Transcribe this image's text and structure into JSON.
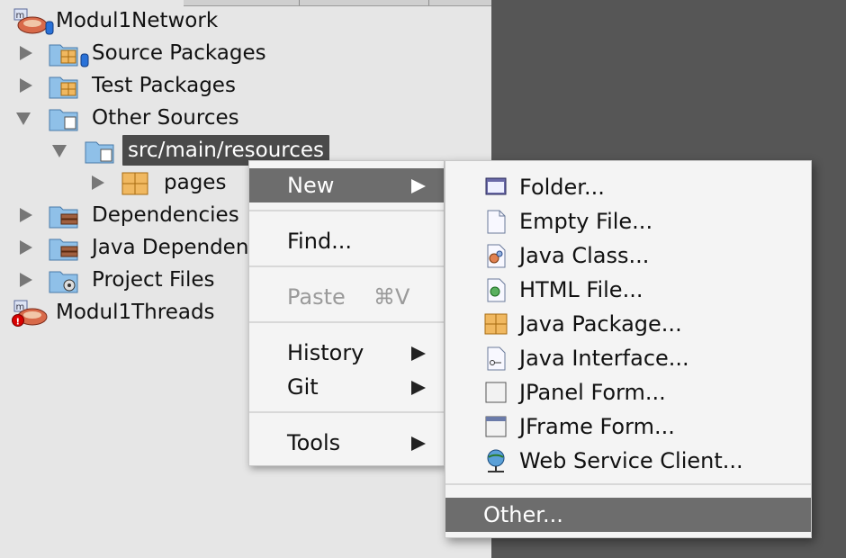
{
  "tree": {
    "nodes": [
      {
        "label": "Modul1Network"
      },
      {
        "label": "Source Packages"
      },
      {
        "label": "Test Packages"
      },
      {
        "label": "Other Sources"
      },
      {
        "label": "src/main/resources"
      },
      {
        "label": "pages"
      },
      {
        "label": "Dependencies"
      },
      {
        "label": "Java Dependencies"
      },
      {
        "label": "Project Files"
      },
      {
        "label": "Modul1Threads"
      }
    ]
  },
  "context_menu": {
    "new_label": "New",
    "find_label": "Find...",
    "paste_label": "Paste",
    "paste_shortcut": "⌘V",
    "history_label": "History",
    "git_label": "Git",
    "tools_label": "Tools"
  },
  "new_submenu": {
    "items": [
      {
        "label": "Folder...",
        "icon": "folder-icon"
      },
      {
        "label": "Empty File...",
        "icon": "empty-file-icon"
      },
      {
        "label": "Java Class...",
        "icon": "java-class-icon"
      },
      {
        "label": "HTML File...",
        "icon": "html-file-icon"
      },
      {
        "label": "Java Package...",
        "icon": "java-package-icon"
      },
      {
        "label": "Java Interface...",
        "icon": "java-interface-icon"
      },
      {
        "label": "JPanel Form...",
        "icon": "jpanel-form-icon"
      },
      {
        "label": "JFrame Form...",
        "icon": "jframe-form-icon"
      },
      {
        "label": "Web Service Client...",
        "icon": "web-service-icon"
      }
    ],
    "other_label": "Other..."
  },
  "colors": {
    "panel_bg": "#e6e6e6",
    "highlight": "#6d6d6d",
    "selection": "#4a4a4a",
    "folder_blue": "#8fc0e8",
    "package_orange": "#f0b860"
  }
}
